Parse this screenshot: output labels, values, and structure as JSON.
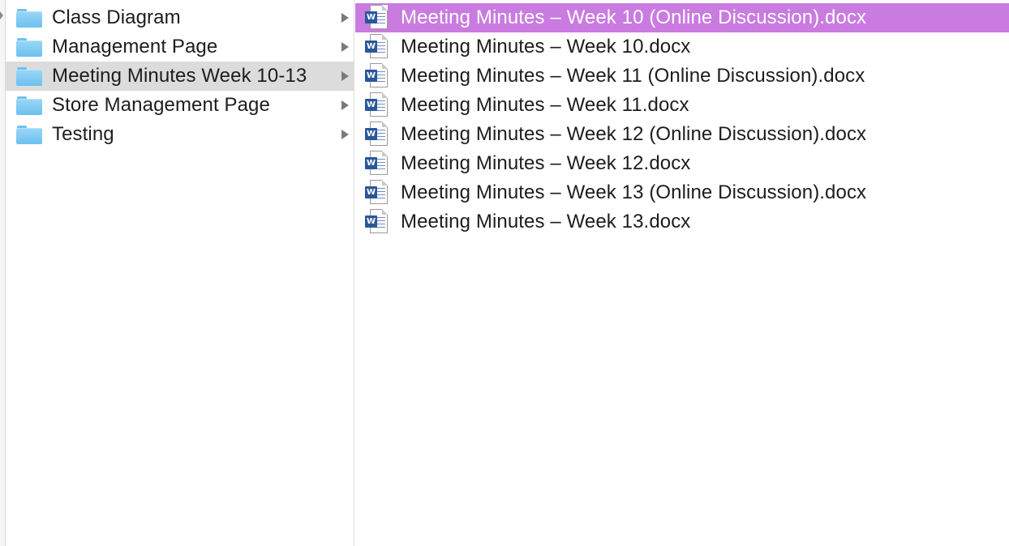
{
  "folders": [
    {
      "label": "Class Diagram",
      "icon": "folder-icon"
    },
    {
      "label": "Management Page",
      "icon": "folder-icon"
    },
    {
      "label": "Meeting Minutes Week 10-13",
      "icon": "folder-icon"
    },
    {
      "label": "Store Management Page",
      "icon": "folder-icon"
    },
    {
      "label": "Testing",
      "icon": "folder-icon"
    }
  ],
  "files": [
    {
      "label": "Meeting Minutes – Week 10 (Online Discussion).docx",
      "icon": "word-document-icon",
      "badge": "W"
    },
    {
      "label": "Meeting Minutes – Week 10.docx",
      "icon": "word-document-icon",
      "badge": "W"
    },
    {
      "label": "Meeting Minutes – Week 11 (Online Discussion).docx",
      "icon": "word-document-icon",
      "badge": "W"
    },
    {
      "label": "Meeting Minutes – Week 11.docx",
      "icon": "word-document-icon",
      "badge": "W"
    },
    {
      "label": "Meeting Minutes – Week 12 (Online Discussion).docx",
      "icon": "word-document-icon",
      "badge": "W"
    },
    {
      "label": "Meeting Minutes – Week 12.docx",
      "icon": "word-document-icon",
      "badge": "W"
    },
    {
      "label": "Meeting Minutes – Week 13 (Online Discussion).docx",
      "icon": "word-document-icon",
      "badge": "W"
    },
    {
      "label": "Meeting Minutes – Week 13.docx",
      "icon": "word-document-icon",
      "badge": "W"
    }
  ],
  "selection": {
    "folder_selected": "Meeting Minutes Week 10-13",
    "file_selected": "Meeting Minutes – Week 10 (Online Discussion).docx"
  },
  "colors": {
    "selected_active_bg": "#c97be0",
    "selected_inactive_bg": "#dcdcdc",
    "folder_blue": "#6cc0ee",
    "word_blue": "#2b579a"
  }
}
